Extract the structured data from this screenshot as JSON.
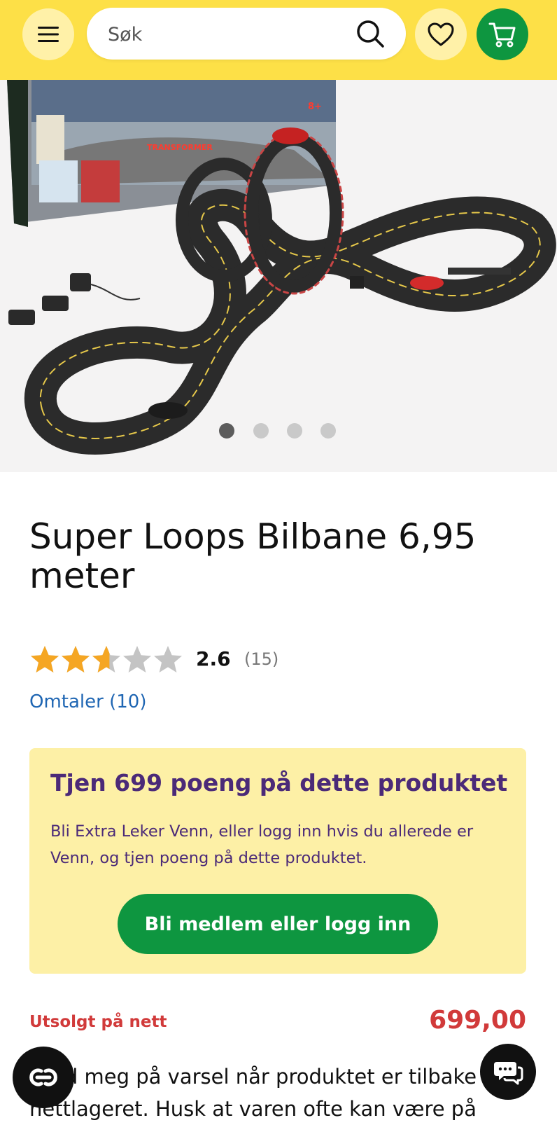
{
  "header": {
    "search_placeholder": "Søk",
    "menu_icon": "hamburger-menu-icon",
    "search_icon": "search-icon",
    "favorites_icon": "heart-icon",
    "cart_icon": "cart-icon",
    "background_color": "#fde047",
    "cart_color": "#0e9640"
  },
  "gallery": {
    "image_count": 4,
    "active_index": 0
  },
  "product": {
    "title": "Super Loops Bilbane 6,95 meter",
    "rating": "2.6",
    "rating_value": 2.6,
    "rating_max": 5,
    "rating_count": "(15)",
    "reviews_link": "Omtaler (10)"
  },
  "points": {
    "title": "Tjen 699 poeng på dette produktet",
    "text": "Bli Extra Leker Venn, eller logg inn hvis du allerede er Venn, og tjen poeng på dette produktet.",
    "button": "Bli medlem eller logg inn"
  },
  "stock": {
    "status": "Utsolgt på nett",
    "price": "699,00",
    "notice": "Meld meg på varsel når produktet er tilbake på nettlageret. Husk at varen ofte kan være på"
  },
  "floating": {
    "left_icon": "accessibility-icon",
    "right_icon": "chat-icon"
  },
  "colors": {
    "green": "#0e9640",
    "purple": "#4b2a78",
    "red": "#d13a3a",
    "star": "#f5a623"
  }
}
